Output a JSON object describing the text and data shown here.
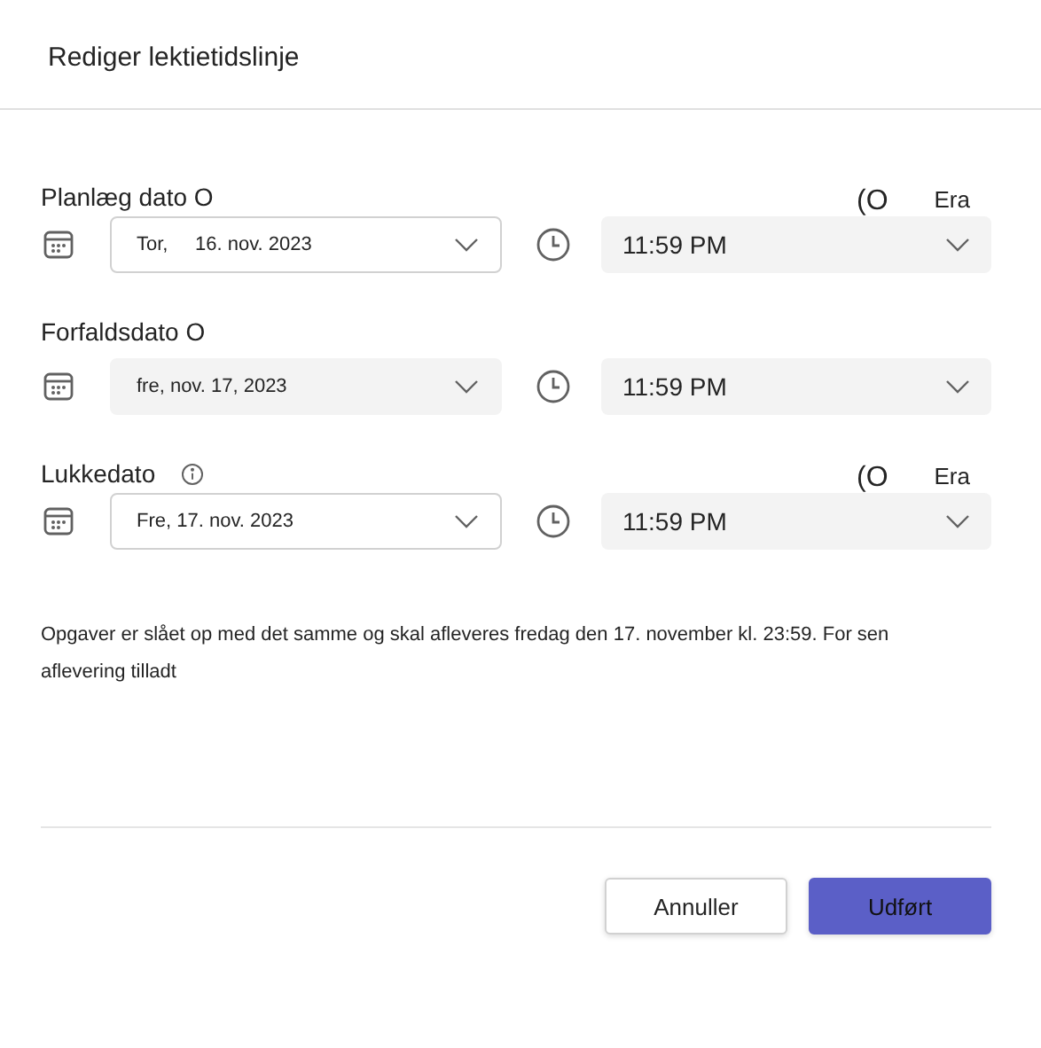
{
  "dialog": {
    "title": "Rediger lektietidslinje"
  },
  "sections": [
    {
      "label": "Planlæg dato O",
      "info": false,
      "extras": [
        "(O",
        "Era"
      ],
      "date": {
        "value": "Tor,     16. nov. 2023",
        "kind": "outlined"
      },
      "time": {
        "value": "11:59 PM"
      }
    },
    {
      "label": "Forfaldsdato O",
      "info": false,
      "date": {
        "value": "fre, nov. 17, 2023",
        "kind": "filled"
      },
      "time": {
        "value": "11:59 PM"
      }
    },
    {
      "label": "Lukkedato",
      "info": true,
      "extras": [
        "(O",
        "Era"
      ],
      "date": {
        "value": "Fre, 17. nov. 2023",
        "kind": "outlined"
      },
      "time": {
        "value": "11:59 PM"
      }
    }
  ],
  "summary": "Opgaver er slået op med det samme og skal afleveres fredag den 17. november kl. 23:59. For sen aflevering tilladt",
  "buttons": [
    {
      "label": "Annuller",
      "kind": "secondary"
    },
    {
      "label": "Udført",
      "kind": "primary"
    }
  ]
}
